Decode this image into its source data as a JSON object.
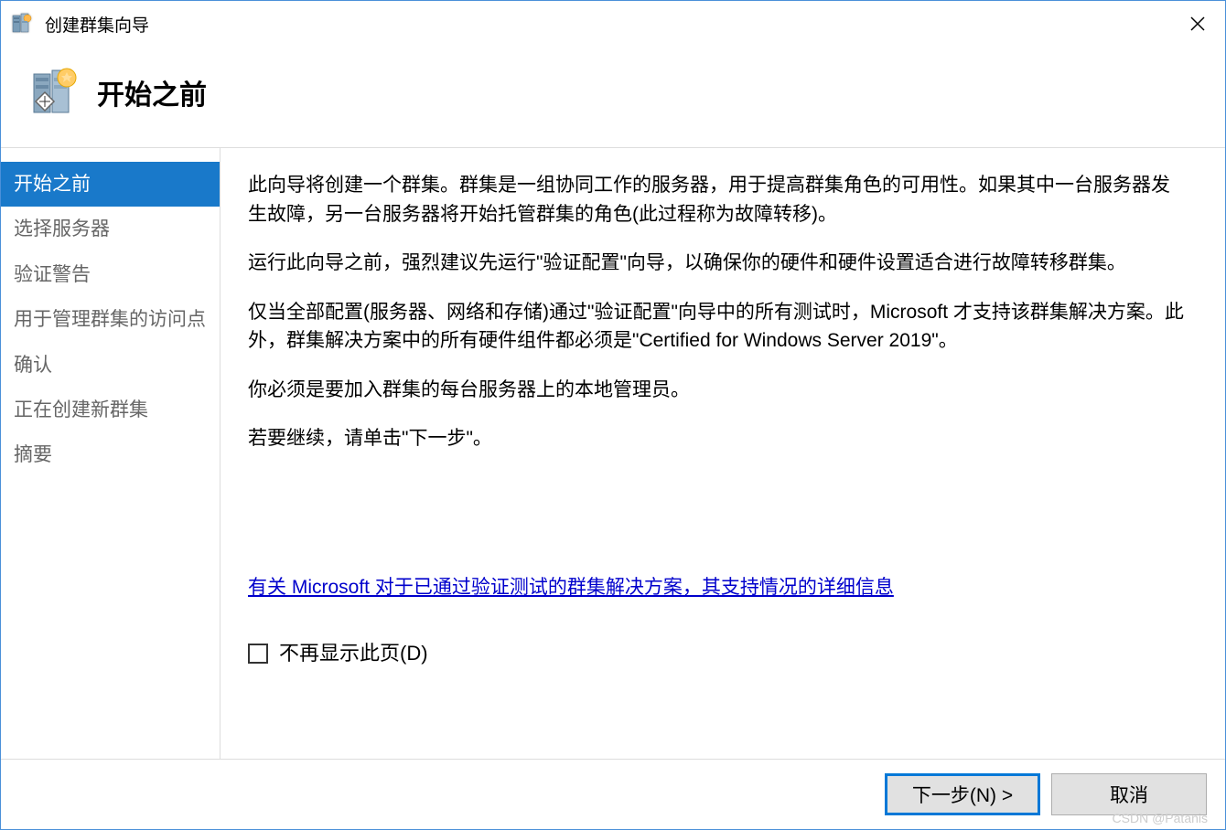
{
  "titlebar": {
    "title": "创建群集向导"
  },
  "header": {
    "title": "开始之前"
  },
  "sidebar": {
    "items": [
      {
        "label": "开始之前",
        "active": true
      },
      {
        "label": "选择服务器",
        "active": false
      },
      {
        "label": "验证警告",
        "active": false
      },
      {
        "label": "用于管理群集的访问点",
        "active": false
      },
      {
        "label": "确认",
        "active": false
      },
      {
        "label": "正在创建新群集",
        "active": false
      },
      {
        "label": "摘要",
        "active": false
      }
    ]
  },
  "content": {
    "para1": "此向导将创建一个群集。群集是一组协同工作的服务器，用于提高群集角色的可用性。如果其中一台服务器发生故障，另一台服务器将开始托管群集的角色(此过程称为故障转移)。",
    "para2": "运行此向导之前，强烈建议先运行\"验证配置\"向导，以确保你的硬件和硬件设置适合进行故障转移群集。",
    "para3": "仅当全部配置(服务器、网络和存储)通过\"验证配置\"向导中的所有测试时，Microsoft 才支持该群集解决方案。此外，群集解决方案中的所有硬件组件都必须是\"Certified for Windows Server 2019\"。",
    "para4": "你必须是要加入群集的每台服务器上的本地管理员。",
    "para5": "若要继续，请单击\"下一步\"。",
    "link": "有关 Microsoft 对于已通过验证测试的群集解决方案，其支持情况的详细信息",
    "checkbox_label": "不再显示此页(D)"
  },
  "buttons": {
    "next": "下一步(N) >",
    "cancel": "取消"
  },
  "watermark": "CSDN @Patanis"
}
